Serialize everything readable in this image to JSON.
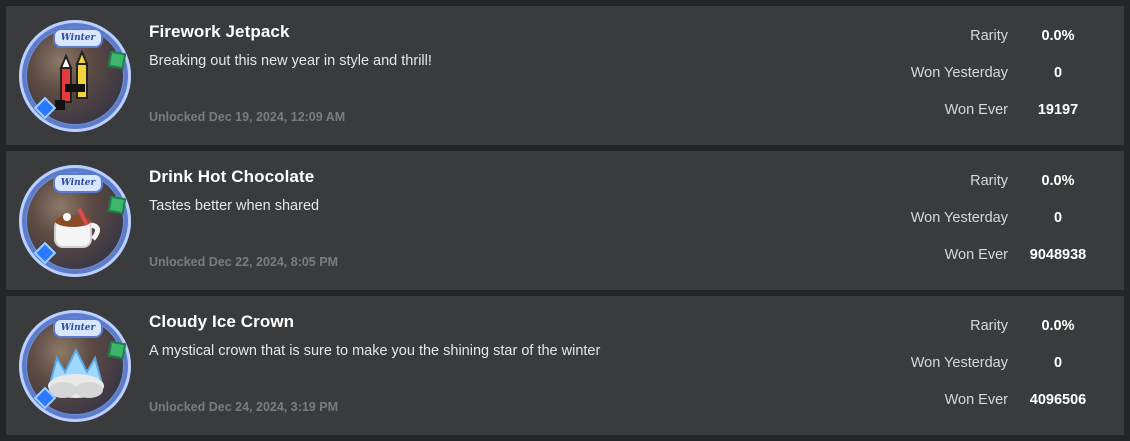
{
  "stat_labels": {
    "rarity": "Rarity",
    "won_yesterday": "Won Yesterday",
    "won_ever": "Won Ever"
  },
  "badges": [
    {
      "title": "Firework Jetpack",
      "description": "Breaking out this new year in style and thrill!",
      "unlocked": "Unlocked Dec 19, 2024, 12:09 AM",
      "rarity": "0.0%",
      "won_yesterday": "0",
      "won_ever": "19197",
      "icon": "firework-jetpack-badge-icon"
    },
    {
      "title": "Drink Hot Chocolate",
      "description": "Tastes better when shared",
      "unlocked": "Unlocked Dec 22, 2024, 8:05 PM",
      "rarity": "0.0%",
      "won_yesterday": "0",
      "won_ever": "9048938",
      "icon": "hot-chocolate-badge-icon"
    },
    {
      "title": "Cloudy Ice Crown",
      "description": "A mystical crown that is sure to make you the shining star of the winter",
      "unlocked": "Unlocked Dec 24, 2024, 3:19 PM",
      "rarity": "0.0%",
      "won_yesterday": "0",
      "won_ever": "4096506",
      "icon": "ice-crown-badge-icon"
    }
  ],
  "badge_banner_text": "Winter",
  "colors": {
    "background": "#232527",
    "card": "#393b3d",
    "title": "#ffffff",
    "date": "#7a7c7e"
  }
}
